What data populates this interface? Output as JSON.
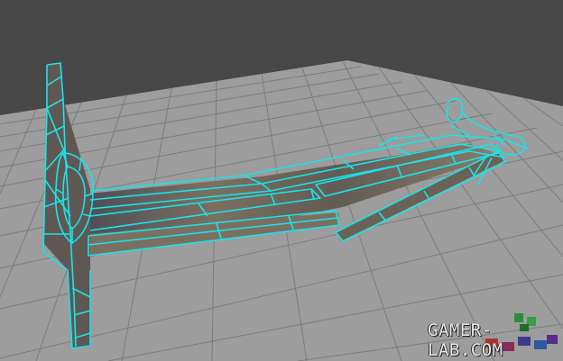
{
  "viewport": {
    "background_color": "#474747",
    "floor_color": "#9d9d9d",
    "grid_color": "#7a7a7a",
    "wireframe_color": "#18e4ec",
    "model_texture_color": "#6b6256"
  },
  "watermark": {
    "text": "GAMER-LAB.COM",
    "logo": "gamer-lab-logo"
  }
}
